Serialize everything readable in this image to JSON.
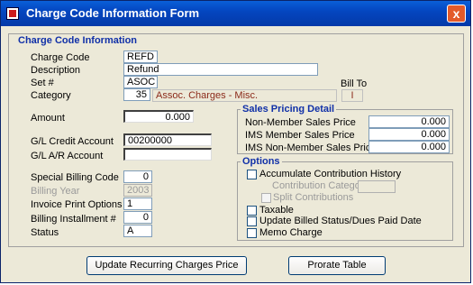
{
  "window": {
    "title": "Charge Code Information Form",
    "close_glyph": "x"
  },
  "charge_code_info": {
    "section_title": "Charge Code Information",
    "charge_code_label": "Charge Code",
    "charge_code_value": "REFD",
    "description_label": "Description",
    "description_value": "Refund",
    "set_label": "Set #",
    "set_value": "ASOC",
    "category_label": "Category",
    "category_value": "35",
    "category_description": "Assoc. Charges - Misc.",
    "bill_to_label": "Bill To",
    "bill_to_value": "I",
    "amount_label": "Amount",
    "amount_value": "0.000",
    "gl_credit_label": "G/L Credit Account",
    "gl_credit_value": "00200000",
    "gl_ar_label": "G/L  A/R Account",
    "gl_ar_value": "",
    "special_billing_label": "Special Billing Code",
    "special_billing_value": "0",
    "billing_year_label": "Billing Year",
    "billing_year_value": "2003",
    "invoice_print_label": "Invoice Print Options",
    "invoice_print_value": "1",
    "billing_installment_label": "Billing Installment #",
    "billing_installment_value": "0",
    "status_label": "Status",
    "status_value": "A"
  },
  "sales_pricing": {
    "title": "Sales Pricing Detail",
    "non_member_label": "Non-Member Sales Price",
    "non_member_value": "0.000",
    "ims_member_label": "IMS Member Sales Price",
    "ims_member_value": "0.000",
    "ims_non_member_label": "IMS Non-Member Sales Price",
    "ims_non_member_value": "0.000"
  },
  "options": {
    "title": "Options",
    "accumulate_label": "Accumulate Contribution History",
    "contribution_category_label": "Contribution Category",
    "contribution_category_value": "",
    "split_label": "Split Contributions",
    "taxable_label": "Taxable",
    "update_billed_label": "Update Billed Status/Dues Paid Date",
    "memo_label": "Memo Charge"
  },
  "buttons": {
    "update_recurring": "Update Recurring Charges Price",
    "prorate_table": "Prorate Table"
  }
}
